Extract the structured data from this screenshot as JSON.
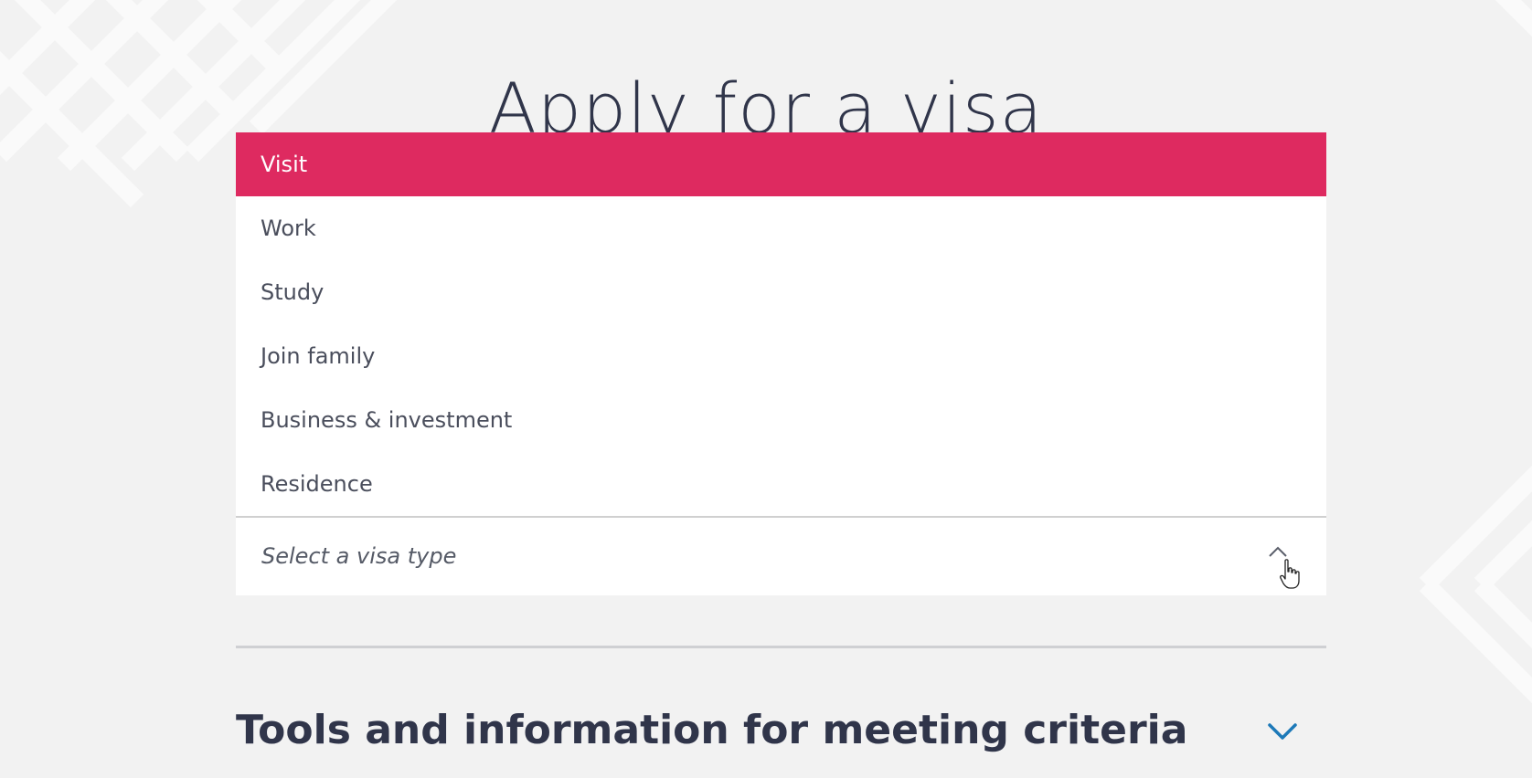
{
  "page": {
    "title": "Apply for a visa"
  },
  "visa_dropdown": {
    "options": [
      {
        "label": "Visit",
        "selected": true
      },
      {
        "label": "Work",
        "selected": false
      },
      {
        "label": "Study",
        "selected": false
      },
      {
        "label": "Join family",
        "selected": false
      },
      {
        "label": "Business & investment",
        "selected": false
      },
      {
        "label": "Residence",
        "selected": false
      }
    ],
    "placeholder": "Select a visa type",
    "expanded": true,
    "toggle_icon": "chevron-up-icon"
  },
  "accordion": {
    "heading": "Tools and information for meeting criteria",
    "toggle_icon": "chevron-down-icon"
  },
  "colors": {
    "background": "#f2f2f2",
    "selected_option": "#de2a60",
    "text_dark": "#30354a",
    "accent_blue": "#1d79b8"
  }
}
